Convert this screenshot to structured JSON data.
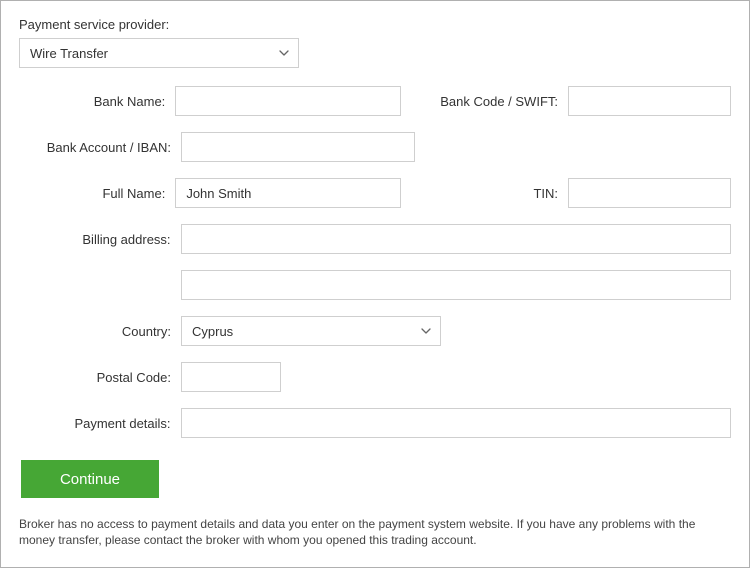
{
  "psp": {
    "label": "Payment service provider:",
    "value": "Wire Transfer"
  },
  "fields": {
    "bank_name": {
      "label": "Bank Name:",
      "value": ""
    },
    "bank_code": {
      "label": "Bank Code / SWIFT:",
      "value": ""
    },
    "iban": {
      "label": "Bank Account / IBAN:",
      "value": ""
    },
    "full_name": {
      "label": "Full Name:",
      "value": "John Smith"
    },
    "tin": {
      "label": "TIN:",
      "value": ""
    },
    "billing_address": {
      "label": "Billing address:",
      "value1": "",
      "value2": ""
    },
    "country": {
      "label": "Country:",
      "value": "Cyprus"
    },
    "postal_code": {
      "label": "Postal Code:",
      "value": ""
    },
    "payment_details": {
      "label": "Payment details:",
      "value": ""
    }
  },
  "actions": {
    "continue": "Continue"
  },
  "disclaimer": "Broker has no access to payment details and data you enter on the payment system website. If you have any problems with the money transfer, please contact the broker with whom you opened this trading account."
}
